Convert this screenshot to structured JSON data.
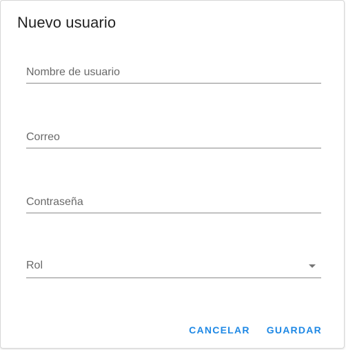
{
  "dialog": {
    "title": "Nuevo usuario",
    "fields": {
      "username": {
        "placeholder": "Nombre de usuario",
        "value": ""
      },
      "email": {
        "placeholder": "Correo",
        "value": ""
      },
      "password": {
        "placeholder": "Contraseña",
        "value": ""
      },
      "role": {
        "label": "Rol",
        "icon": "chevron-down-icon"
      }
    },
    "actions": {
      "cancel_label": "CANCELAR",
      "save_label": "GUARDAR"
    },
    "colors": {
      "accent": "#1e88e5",
      "divider": "#8a8a8a"
    }
  }
}
